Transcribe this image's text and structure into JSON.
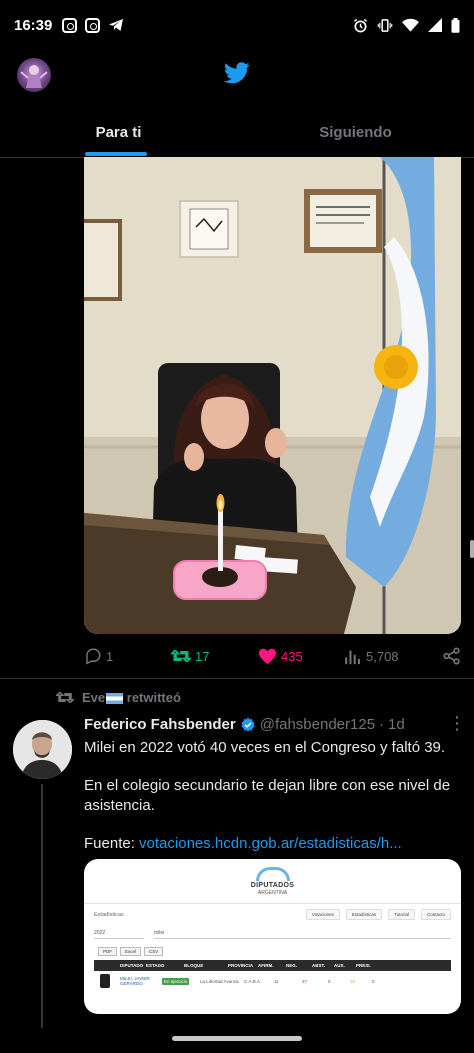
{
  "status_bar": {
    "time": "16:39",
    "left_icons": [
      "instagram-icon",
      "instagram-icon",
      "telegram-icon"
    ],
    "right_icons": [
      "alarm-icon",
      "vibrate-icon",
      "wifi-icon",
      "signal-icon",
      "battery-icon"
    ]
  },
  "header": {
    "logo_icon": "twitter-bird-icon",
    "brand_color": "#1d9bf0"
  },
  "tabs": [
    {
      "label": "Para ti",
      "active": true
    },
    {
      "label": "Siguiendo",
      "active": false
    }
  ],
  "tweet1": {
    "media_description_icon": "photo",
    "actions": {
      "reply_count": "1",
      "retweet_count": "17",
      "like_count": "435",
      "views_count": "5,708"
    },
    "colors": {
      "retweet": "#00ba7c",
      "like": "#f91880",
      "muted": "#71767b"
    }
  },
  "tweet2": {
    "retweeted_by": "Eve",
    "retweeted_suffix": "retwitteó",
    "author_name": "Federico Fahsbender",
    "verified": true,
    "handle": "@fahsbender125",
    "separator": "·",
    "time_ago": "1d",
    "text_line1": "Milei en 2022 votó 40 veces en el Congreso y faltó 39.",
    "text_line2": "En el colegio secundario te dejan libre con ese nivel de asistencia.",
    "source_label": "Fuente:",
    "source_link": "votaciones.hcdn.gob.ar/estadisticas/h...",
    "card": {
      "title": "DIPUTADOS",
      "subtitle": "ARGENTINA",
      "section": "Estadísticas",
      "nav_items": [
        "Votaciones",
        "Estadísticas",
        "Tutorial",
        "Contacto"
      ],
      "filter_year": "2022",
      "filter_query": "milei",
      "export_buttons": [
        "PDF",
        "Excel",
        "CSV"
      ],
      "columns": [
        "DIPUTADO",
        "ESTADO",
        "BLOQUE",
        "PROVINCIA",
        "AFIRM.",
        "NEG.",
        "ABST.",
        "AUS.",
        "PRESI."
      ],
      "row": {
        "name": "MILEI, JAVIER GERARDO",
        "status": "En ejercicio",
        "bloc": "La Libertad Avanza",
        "province": "C.A.B.A.",
        "afirm": "11",
        "neg": "27",
        "abst": "0",
        "aus": "39",
        "presi": "0"
      }
    }
  }
}
